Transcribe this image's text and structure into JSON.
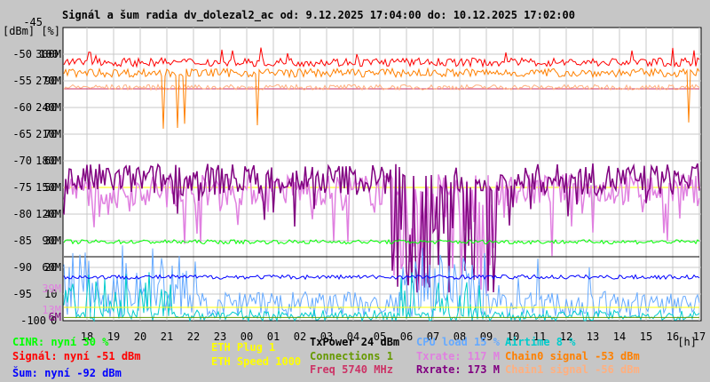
{
  "chart_data": {
    "type": "line",
    "title": "Signál a šum radia dv_dolezal2_ac od: 9.12.2025 17:04:00 do: 10.12.2025 17:02:00",
    "ylabel": "[dBm] [%]",
    "xlabel": "[h]",
    "ylim": [
      -100,
      -45
    ],
    "y_ticks_dbm": [
      "-45",
      "-50",
      "-55",
      "-60",
      "-65",
      "-70",
      "-75",
      "-80",
      "-85",
      "-90",
      "-95",
      "-100"
    ],
    "y_ticks_pct": [
      "",
      "100",
      "90",
      "80",
      "70",
      "60",
      "50",
      "40",
      "30",
      "20",
      "10",
      "0"
    ],
    "y_ticks_rate": [
      "",
      "300M",
      "270M",
      "240M",
      "210M",
      "180M",
      "150M",
      "120M",
      "90M",
      "60M",
      "",
      ""
    ],
    "y_extra_ticks": [
      {
        "label": "39M",
        "color": "#e080e0",
        "dbm": -94
      },
      {
        "label": "13M",
        "color": "#e080e0",
        "dbm": -98
      },
      {
        "label": "6M",
        "color": "#800080",
        "dbm": -99.3
      }
    ],
    "x_ticks": [
      "18",
      "19",
      "20",
      "21",
      "22",
      "23",
      "00",
      "01",
      "02",
      "03",
      "04",
      "05",
      "06",
      "07",
      "08",
      "09",
      "10",
      "11",
      "12",
      "13",
      "14",
      "15",
      "16",
      "17"
    ],
    "x_start_hour_offset": -0.93,
    "grid": true,
    "series": [
      {
        "name": "CINR",
        "color": "#00ff00",
        "level": -85.2,
        "noise": 0.4
      },
      {
        "name": "Signál",
        "color": "#ff0000",
        "level": -51.5,
        "noise": 0.8
      },
      {
        "name": "Šum",
        "color": "#0000ff",
        "level": -91.8,
        "noise": 0.4
      },
      {
        "name": "ETH Plug",
        "color": "#ffff00",
        "level": -97.5,
        "noise": 0
      },
      {
        "name": "ETH Speed",
        "color": "#ffff00",
        "level": -75.0,
        "noise": 0
      },
      {
        "name": "TxPower",
        "color": "#000000",
        "level": -88.0,
        "noise": 0
      },
      {
        "name": "Connections",
        "color": "#669900",
        "level": -99.4,
        "noise": 0
      },
      {
        "name": "Freq",
        "color": "#cc3366",
        "level": -56.5,
        "noise": 0
      },
      {
        "name": "CPU load",
        "color": "#66aaff",
        "level": -97,
        "noise": 2.5
      },
      {
        "name": "Txrate",
        "color": "#e080e0",
        "level": -75.5,
        "noise": 3
      },
      {
        "name": "Rxrate",
        "color": "#800080",
        "level": -73.5,
        "noise": 3
      },
      {
        "name": "Airtime",
        "color": "#00cccc",
        "level": -99,
        "noise": 1
      },
      {
        "name": "Chain0 signal",
        "color": "#ff8000",
        "level": -53.5,
        "noise": 0.8
      },
      {
        "name": "Chain1 signal",
        "color": "#ffb080",
        "level": -56.2,
        "noise": 0.5
      }
    ]
  },
  "legend": [
    {
      "text": "CINR: nyní 30 %",
      "color": "#00ff00"
    },
    {
      "text": "Signál: nyní -51 dBm",
      "color": "#ff0000"
    },
    {
      "text": "Šum: nyní -92 dBm",
      "color": "#0000ff"
    },
    {
      "text": "ETH Plug 1",
      "color": "#ffff00"
    },
    {
      "text": "ETH Speed 1000",
      "color": "#ffff00"
    },
    {
      "text": "TxPower 24 dBm",
      "color": "#000000"
    },
    {
      "text": "Connections 1",
      "color": "#669900"
    },
    {
      "text": "Freq 5740 MHz",
      "color": "#cc3366"
    },
    {
      "text": "CPU load 15 %",
      "color": "#66aaff"
    },
    {
      "text": "Txrate: 117 M",
      "color": "#e080e0"
    },
    {
      "text": "Rxrate: 173 M",
      "color": "#800080"
    },
    {
      "text": "Airtime 8 %",
      "color": "#00cccc"
    },
    {
      "text": "Chain0 signal -53 dBm",
      "color": "#ff8000"
    },
    {
      "text": "Chain1 signal -56 dBm",
      "color": "#ffb080"
    }
  ]
}
